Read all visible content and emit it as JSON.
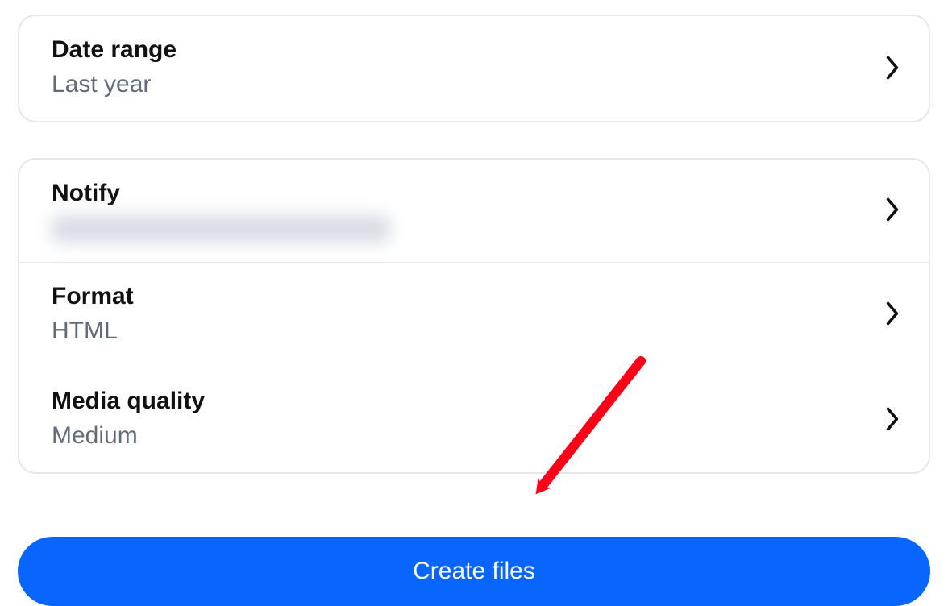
{
  "section1": {
    "dateRange": {
      "title": "Date range",
      "value": "Last year"
    }
  },
  "section2": {
    "notify": {
      "title": "Notify",
      "value": ""
    },
    "format": {
      "title": "Format",
      "value": "HTML"
    },
    "mediaQuality": {
      "title": "Media quality",
      "value": "Medium"
    }
  },
  "cta": {
    "label": "Create files"
  }
}
